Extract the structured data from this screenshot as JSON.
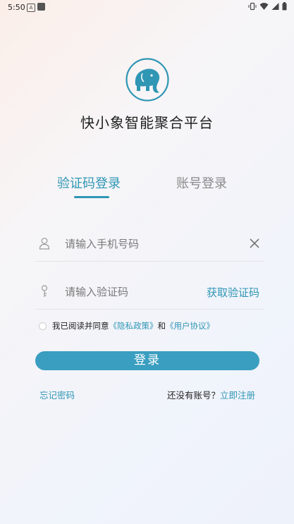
{
  "status_bar": {
    "time": "5:50",
    "app_icon_letter": "A"
  },
  "app": {
    "title": "快小象智能聚合平台"
  },
  "tabs": [
    {
      "label": "验证码登录",
      "active": true
    },
    {
      "label": "账号登录",
      "active": false
    }
  ],
  "form": {
    "phone_placeholder": "请输入手机号码",
    "code_placeholder": "请输入验证码",
    "get_code_label": "获取验证码"
  },
  "agreement": {
    "prefix": "我已阅读并同意",
    "privacy": "《隐私政策》",
    "and": "和",
    "user_agreement": "《用户协议》"
  },
  "login_button": "登录",
  "footer": {
    "forgot_password": "忘记密码",
    "no_account": "还没有账号？",
    "register": "立即注册"
  },
  "colors": {
    "accent": "#2f96b4",
    "button": "#3a9ec0"
  }
}
